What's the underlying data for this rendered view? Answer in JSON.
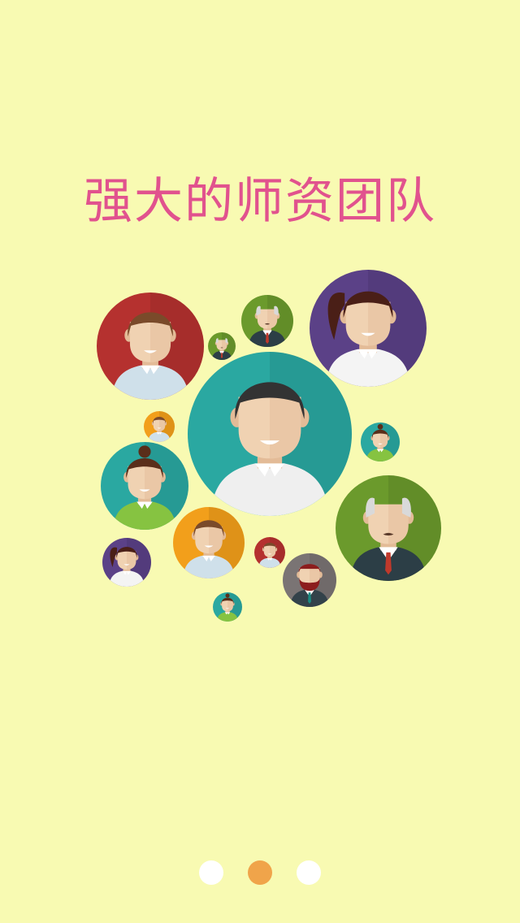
{
  "title": "强大的师资团队",
  "pager": {
    "total": 3,
    "active_index": 1
  },
  "colors": {
    "background": "#f8fab2",
    "title": "#e1528e",
    "dot_active": "#f0a44a",
    "dot_inactive": "#ffffff",
    "teal": "#2aa8a1",
    "red": "#b5312f",
    "purple": "#5b4187",
    "olive": "#6b9a2c",
    "orange": "#f29f1b",
    "gray": "#7a7474"
  },
  "avatars": [
    {
      "name": "avatar-teal-main",
      "bg": "#2aa8a1",
      "kind": "man-dark"
    },
    {
      "name": "avatar-red-man",
      "bg": "#b5312f",
      "kind": "man-brown"
    },
    {
      "name": "avatar-purple-woman",
      "bg": "#5b4187",
      "kind": "woman-pony"
    },
    {
      "name": "avatar-olive-old-man",
      "bg": "#6b9a2c",
      "kind": "old-man"
    },
    {
      "name": "avatar-teal-woman-bun",
      "bg": "#2aa8a1",
      "kind": "woman-bun"
    },
    {
      "name": "avatar-orange-man",
      "bg": "#f29f1b",
      "kind": "man-brown"
    },
    {
      "name": "avatar-gray-bearded",
      "bg": "#7a7474",
      "kind": "bearded"
    },
    {
      "name": "avatar-purple-small-woman",
      "bg": "#5b4187",
      "kind": "woman-pony"
    },
    {
      "name": "avatar-olive-small-old",
      "bg": "#6b9a2c",
      "kind": "old-man"
    },
    {
      "name": "avatar-olive-tiny-old",
      "bg": "#6b9a2c",
      "kind": "old-man"
    },
    {
      "name": "avatar-orange-tiny",
      "bg": "#f29f1b",
      "kind": "man-brown"
    },
    {
      "name": "avatar-teal-small-woman",
      "bg": "#2aa8a1",
      "kind": "woman-bun"
    },
    {
      "name": "avatar-red-tiny",
      "bg": "#b5312f",
      "kind": "man-brown"
    },
    {
      "name": "avatar-teal-tiny",
      "bg": "#2aa8a1",
      "kind": "woman-bun"
    }
  ]
}
